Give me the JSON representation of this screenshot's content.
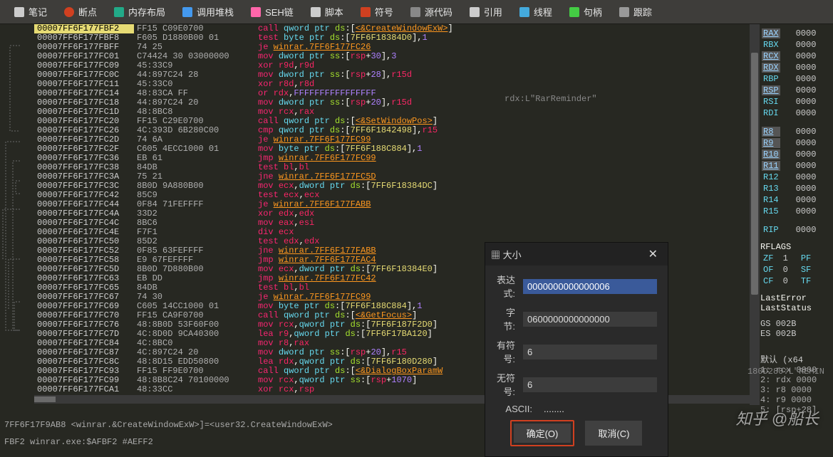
{
  "toolbar": [
    {
      "icon": "file",
      "label": "笔记",
      "color": "#e6e6e6"
    },
    {
      "icon": "dot-red",
      "label": "断点",
      "color": "#e6e6e6"
    },
    {
      "icon": "grid",
      "label": "内存布局",
      "color": "#e6e6e6"
    },
    {
      "icon": "stack",
      "label": "调用堆栈",
      "color": "#e6e6e6"
    },
    {
      "icon": "seh",
      "label": "SEH链",
      "color": "#e6e6e6"
    },
    {
      "icon": "script",
      "label": "脚本",
      "color": "#e6e6e6"
    },
    {
      "icon": "sym",
      "label": "符号",
      "color": "#e6e6e6"
    },
    {
      "icon": "code",
      "label": "源代码",
      "color": "#e6e6e6"
    },
    {
      "icon": "ref",
      "label": "引用",
      "color": "#e6e6e6"
    },
    {
      "icon": "thread",
      "label": "线程",
      "color": "#e6e6e6"
    },
    {
      "icon": "handle",
      "label": "句柄",
      "color": "#e6e6e6"
    },
    {
      "icon": "trace",
      "label": "跟踪",
      "color": "#e6e6e6"
    }
  ],
  "rows": [
    {
      "addr": "00007FF6F177FBF2",
      "bytes": "FF15 C09E0700",
      "asm": "<span class=mn>call</span> <span class=kw>qword ptr</span> <span class=seg>ds</span>:[<span class=sym>&lt;&amp;CreateWindowExW&gt;</span>]",
      "hi": true,
      "bp": "red"
    },
    {
      "addr": "00007FF6F177FBF8",
      "bytes": "F605 D1880B00 01",
      "asm": "<span class=mn>test</span> <span class=kw>byte ptr</span> <span class=seg>ds</span>:[<span class=hex>7FF6F18384D0</span>],<span class=num>1</span>",
      "bp": "gray"
    },
    {
      "addr": "00007FF6F177FBFF",
      "bytes": "74 25",
      "asm": "<span class=mn>je</span> <span class=sym>winrar.7FF6F177FC26</span>",
      "bp": "gray"
    },
    {
      "addr": "00007FF6F177FC01",
      "bytes": "C74424 30 03000000",
      "asm": "<span class=mn>mov</span> <span class=kw>dword ptr</span> <span class=seg>ss</span>:[<span class=reg>rsp</span>+<span class=num>30</span>],<span class=num>3</span>",
      "bp": "gray"
    },
    {
      "addr": "00007FF6F177FC09",
      "bytes": "45:33C9",
      "asm": "<span class=mn>xor</span> <span class=reg>r9d</span>,<span class=reg>r9d</span>",
      "bp": "gray"
    },
    {
      "addr": "00007FF6F177FC0C",
      "bytes": "44:897C24 28",
      "asm": "<span class=mn>mov</span> <span class=kw>dword ptr</span> <span class=seg>ss</span>:[<span class=reg>rsp</span>+<span class=num>28</span>],<span class=reg>r15d</span>",
      "bp": "gray"
    },
    {
      "addr": "00007FF6F177FC11",
      "bytes": "45:33C0",
      "asm": "<span class=mn>xor</span> <span class=reg>r8d</span>,<span class=reg>r8d</span>",
      "bp": "gray"
    },
    {
      "addr": "00007FF6F177FC14",
      "bytes": "48:83CA FF",
      "asm": "<span class=mn>or</span> <span class=reg>rdx</span>,<span class=num>FFFFFFFFFFFFFFFF</span>",
      "bp": "gray"
    },
    {
      "addr": "00007FF6F177FC18",
      "bytes": "44:897C24 20",
      "asm": "<span class=mn>mov</span> <span class=kw>dword ptr</span> <span class=seg>ss</span>:[<span class=reg>rsp</span>+<span class=num>20</span>],<span class=reg>r15d</span>",
      "bp": "gray"
    },
    {
      "addr": "00007FF6F177FC1D",
      "bytes": "48:8BC8",
      "asm": "<span class=mn>mov</span> <span class=reg>rcx</span>,<span class=reg>rax</span>",
      "bp": "gray"
    },
    {
      "addr": "00007FF6F177FC20",
      "bytes": "FF15 C29E0700",
      "asm": "<span class=mn>call</span> <span class=kw>qword ptr</span> <span class=seg>ds</span>:[<span class=sym>&lt;&amp;SetWindowPos&gt;</span>]",
      "bp": "gray"
    },
    {
      "addr": "00007FF6F177FC26",
      "bytes": "4C:393D 6B280C00",
      "asm": "<span class=mn>cmp</span> <span class=kw>qword ptr</span> <span class=seg>ds</span>:[<span class=hex>7FF6F1842498</span>],<span class=reg>r15</span>",
      "bp": "gray"
    },
    {
      "addr": "00007FF6F177FC2D",
      "bytes": "74 6A",
      "asm": "<span class=mn>je</span> <span class=sym>winrar.7FF6F177FC99</span>",
      "bp": "gray"
    },
    {
      "addr": "00007FF6F177FC2F",
      "bytes": "C605 4ECC1000 01",
      "asm": "<span class=mn>mov</span> <span class=kw>byte ptr</span> <span class=seg>ds</span>:[<span class=hex>7FF6F188C884</span>],<span class=num>1</span>",
      "bp": "gray"
    },
    {
      "addr": "00007FF6F177FC36",
      "bytes": "EB 61",
      "asm": "<span class=mn>jmp</span> <span class=sym>winrar.7FF6F177FC99</span>",
      "bp": "gray"
    },
    {
      "addr": "00007FF6F177FC38",
      "bytes": "84DB",
      "asm": "<span class=mn>test</span> <span class=reg>bl</span>,<span class=reg>bl</span>",
      "bp": "gray"
    },
    {
      "addr": "00007FF6F177FC3A",
      "bytes": "75 21",
      "asm": "<span class=mn>jne</span> <span class=sym>winrar.7FF6F177FC5D</span>",
      "bp": "gray"
    },
    {
      "addr": "00007FF6F177FC3C",
      "bytes": "8B0D 9A880B00",
      "asm": "<span class=mn>mov</span> <span class=reg>ecx</span>,<span class=kw>dword ptr</span> <span class=seg>ds</span>:[<span class=hex>7FF6F18384DC</span>]",
      "bp": "gray"
    },
    {
      "addr": "00007FF6F177FC42",
      "bytes": "85C9",
      "asm": "<span class=mn>test</span> <span class=reg>ecx</span>,<span class=reg>ecx</span>",
      "bp": "gray"
    },
    {
      "addr": "00007FF6F177FC44",
      "bytes": "0F84 71FEFFFF",
      "asm": "<span class=mn>je</span> <span class=sym>winrar.7FF6F177FABB</span>",
      "bp": "gray"
    },
    {
      "addr": "00007FF6F177FC4A",
      "bytes": "33D2",
      "asm": "<span class=mn>xor</span> <span class=reg>edx</span>,<span class=reg>edx</span>",
      "bp": "gray"
    },
    {
      "addr": "00007FF6F177FC4C",
      "bytes": "8BC6",
      "asm": "<span class=mn>mov</span> <span class=reg>eax</span>,<span class=reg>esi</span>",
      "bp": "gray"
    },
    {
      "addr": "00007FF6F177FC4E",
      "bytes": "F7F1",
      "asm": "<span class=mn>div</span> <span class=reg>ecx</span>",
      "bp": "gray"
    },
    {
      "addr": "00007FF6F177FC50",
      "bytes": "85D2",
      "asm": "<span class=mn>test</span> <span class=reg>edx</span>,<span class=reg>edx</span>",
      "bp": "gray"
    },
    {
      "addr": "00007FF6F177FC52",
      "bytes": "0F85 63FEFFFF",
      "asm": "<span class=mn>jne</span> <span class=sym>winrar.7FF6F177FABB</span>",
      "bp": "gray"
    },
    {
      "addr": "00007FF6F177FC58",
      "bytes": "E9 67FEFFFF",
      "asm": "<span class=mn>jmp</span> <span class=sym>winrar.7FF6F177FAC4</span>",
      "bp": "gray"
    },
    {
      "addr": "00007FF6F177FC5D",
      "bytes": "8B0D 7D880B00",
      "asm": "<span class=mn>mov</span> <span class=reg>ecx</span>,<span class=kw>dword ptr</span> <span class=seg>ds</span>:[<span class=hex>7FF6F18384E0</span>]",
      "bp": "gray"
    },
    {
      "addr": "00007FF6F177FC63",
      "bytes": "EB DD",
      "asm": "<span class=mn>jmp</span> <span class=sym>winrar.7FF6F177FC42</span>",
      "bp": "gray"
    },
    {
      "addr": "00007FF6F177FC65",
      "bytes": "84DB",
      "asm": "<span class=mn>test</span> <span class=reg>bl</span>,<span class=reg>bl</span>",
      "bp": "gray"
    },
    {
      "addr": "00007FF6F177FC67",
      "bytes": "74 30",
      "asm": "<span class=mn>je</span> <span class=sym>winrar.7FF6F177FC99</span>",
      "bp": "gray"
    },
    {
      "addr": "00007FF6F177FC69",
      "bytes": "C605 14CC1000 01",
      "asm": "<span class=mn>mov</span> <span class=kw>byte ptr</span> <span class=seg>ds</span>:[<span class=hex>7FF6F188C884</span>],<span class=num>1</span>",
      "bp": "gray"
    },
    {
      "addr": "00007FF6F177FC70",
      "bytes": "FF15 CA9F0700",
      "asm": "<span class=mn>call</span> <span class=kw>qword ptr</span> <span class=seg>ds</span>:[<span class=sym>&lt;&amp;GetFocus&gt;</span>]",
      "bp": "gray"
    },
    {
      "addr": "00007FF6F177FC76",
      "bytes": "48:8B0D 53F60F00",
      "asm": "<span class=mn>mov</span> <span class=reg>rcx</span>,<span class=kw>qword ptr</span> <span class=seg>ds</span>:[<span class=hex>7FF6F187F2D0</span>]",
      "bp": "gray"
    },
    {
      "addr": "00007FF6F177FC7D",
      "bytes": "4C:8D0D 9CA40300",
      "asm": "<span class=mn>lea</span> <span class=reg>r9</span>,<span class=kw>qword ptr</span> <span class=seg>ds</span>:[<span class=hex>7FF6F17BA120</span>]",
      "bp": "gray"
    },
    {
      "addr": "00007FF6F177FC84",
      "bytes": "4C:8BC0",
      "asm": "<span class=mn>mov</span> <span class=reg>r8</span>,<span class=reg>rax</span>",
      "bp": "gray"
    },
    {
      "addr": "00007FF6F177FC87",
      "bytes": "4C:897C24 20",
      "asm": "<span class=mn>mov</span> <span class=kw>dword ptr</span> <span class=seg>ss</span>:[<span class=reg>rsp</span>+<span class=num>20</span>],<span class=reg>r15</span>",
      "bp": "gray"
    },
    {
      "addr": "00007FF6F177FC8C",
      "bytes": "48:8D15 EDD50800",
      "asm": "<span class=mn>lea</span> <span class=reg>rdx</span>,<span class=kw>qword ptr</span> <span class=seg>ds</span>:[<span class=hex>7FF6F180D280</span>]",
      "bp": "gray"
    },
    {
      "addr": "00007FF6F177FC93",
      "bytes": "FF15 FF9E0700",
      "asm": "<span class=mn>call</span> <span class=kw>qword ptr</span> <span class=seg>ds</span>:[<span class=sym>&lt;&amp;DialogBoxParamW</span>",
      "bp": "gray"
    },
    {
      "addr": "00007FF6F177FC99",
      "bytes": "48:8B8C24 70100000",
      "asm": "<span class=mn>mov</span> <span class=reg>rcx</span>,<span class=kw>qword ptr</span> <span class=seg>ss</span>:[<span class=reg>rsp</span>+<span class=num>1070</span>]",
      "bp": "gray"
    },
    {
      "addr": "00007FF6F177FCA1",
      "bytes": "48:33CC",
      "asm": "<span class=mn>xor</span> <span class=reg>rcx</span>,<span class=reg>rsp</span>",
      "bp": "gray"
    }
  ],
  "hint": "rdx:L\"RarReminder\"",
  "hint2": "180D280:L\"REMIN",
  "regs": [
    {
      "n": "RAX",
      "v": "0000",
      "hl": true
    },
    {
      "n": "RBX",
      "v": "0000"
    },
    {
      "n": "RCX",
      "v": "0000",
      "hl": true
    },
    {
      "n": "RDX",
      "v": "0000",
      "hl": true
    },
    {
      "n": "RBP",
      "v": "0000"
    },
    {
      "n": "RSP",
      "v": "0000",
      "hl": true
    },
    {
      "n": "RSI",
      "v": "0000"
    },
    {
      "n": "RDI",
      "v": "0000"
    }
  ],
  "regs2": [
    {
      "n": "R8",
      "v": "0000",
      "hl": true
    },
    {
      "n": "R9",
      "v": "0000",
      "hl": true
    },
    {
      "n": "R10",
      "v": "0000",
      "hl": true
    },
    {
      "n": "R11",
      "v": "0000",
      "hl": true
    },
    {
      "n": "R12",
      "v": "0000"
    },
    {
      "n": "R13",
      "v": "0000"
    },
    {
      "n": "R14",
      "v": "0000"
    },
    {
      "n": "R15",
      "v": "0000"
    }
  ],
  "rip": {
    "n": "RIP",
    "v": "0000"
  },
  "rflags": "RFLAGS",
  "flags": [
    {
      "n": "ZF",
      "v": "1",
      "n2": "PF"
    },
    {
      "n": "OF",
      "v": "0",
      "n2": "SF"
    },
    {
      "n": "CF",
      "v": "0",
      "n2": "TF"
    }
  ],
  "lasterr": [
    "LastError",
    "LastStatus"
  ],
  "segs": [
    "GS 002B",
    "ES 002B"
  ],
  "stack_title": "默认 (x64",
  "stack": [
    "1: rcx 0000",
    "2: rdx 0000",
    "3: r8  0000",
    "4: r9  0000",
    "5: [rsp+28]"
  ],
  "status": {
    "l1": "7FF6F17F9AB8 <winrar.&CreateWindowExW>]=<user32.CreateWindowExW>",
    "l2": "FBF2 winrar.exe:$AFBF2 #AEFF2"
  },
  "dialog": {
    "title": "大小",
    "expr_label": "表达式:",
    "expr_value": "0000000000000006",
    "bytes_label": "字节:",
    "bytes_value": "0600000000000000",
    "signed_label": "有符号:",
    "signed_value": "6",
    "unsigned_label": "无符号:",
    "unsigned_value": "6",
    "ascii_label": "ASCII:",
    "ascii_value": "........",
    "ok": "确定(O)",
    "cancel": "取消(C)"
  },
  "watermark": "知乎 @船长"
}
